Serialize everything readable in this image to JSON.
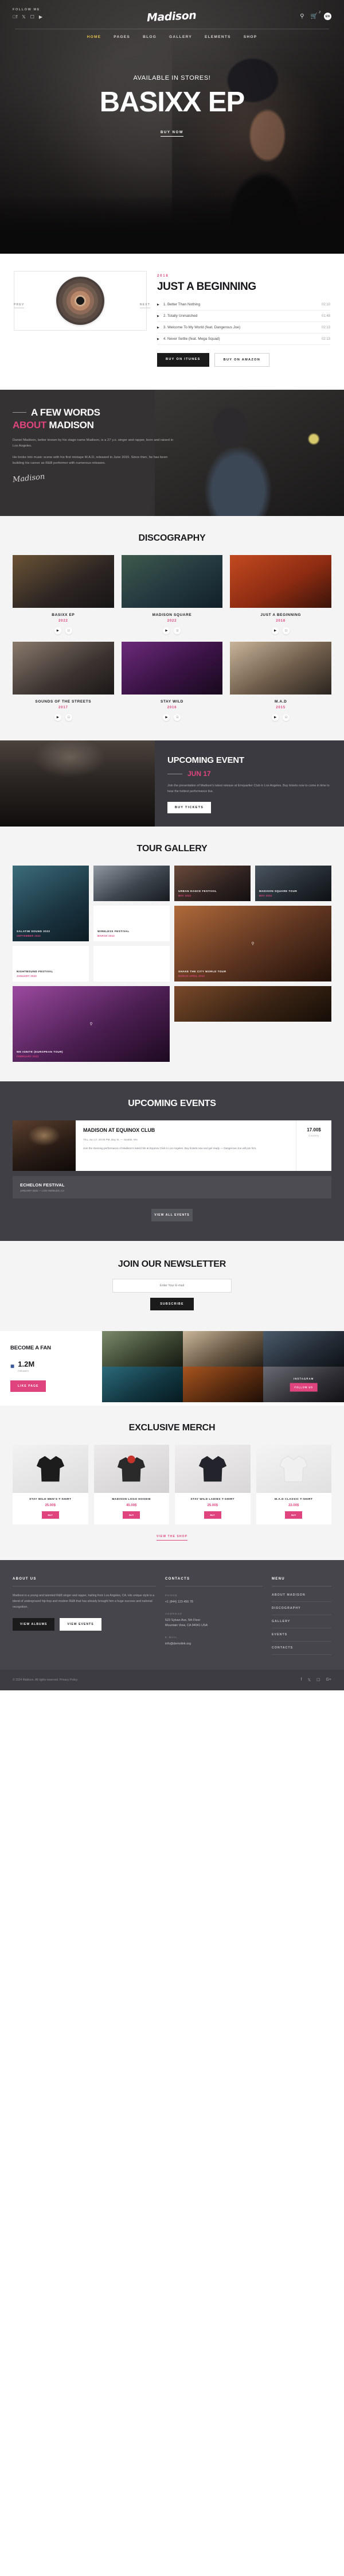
{
  "header": {
    "follow_label": "FOLLOW ME",
    "social": [
      "facebook-icon",
      "twitter-icon",
      "instagram-icon",
      "youtube-icon"
    ],
    "brand": "Madison",
    "search_icon": "search-icon",
    "cart_icon": "cart-icon",
    "cart_count": "2",
    "lang": "EN",
    "nav": [
      {
        "label": "HOME",
        "active": true
      },
      {
        "label": "PAGES",
        "active": false
      },
      {
        "label": "BLOG",
        "active": false
      },
      {
        "label": "GALLERY",
        "active": false
      },
      {
        "label": "ELEMENTS",
        "active": false
      },
      {
        "label": "SHOP",
        "active": false
      }
    ]
  },
  "hero": {
    "eyebrow": "AVAILABLE IN STORES!",
    "title": "BASIXX EP",
    "cta": "BUY NOW"
  },
  "album": {
    "prev": "PREV",
    "next": "NEXT",
    "year": "2018",
    "title": "JUST A BEGINNING",
    "tracks": [
      {
        "name": "1. Better Than Nothing",
        "duration": "02:10"
      },
      {
        "name": "2. Totally Unmatched",
        "duration": "01:48"
      },
      {
        "name": "3. Welcome To My World (feat. Dangerous Joe)",
        "duration": "02:13"
      },
      {
        "name": "4. Never Settle (feat. Mega Squad)",
        "duration": "02:13"
      }
    ],
    "buy_itunes": "BUY ON ITUNES",
    "buy_amazon": "BUY ON AMAZON"
  },
  "about": {
    "heading_line1": "A FEW WORDS",
    "heading_pink": "ABOUT",
    "heading_rest": "MADISON",
    "para1": "Daniel Madison, better known by his stage name Madison, is a 27 y.o. singer and rapper, born and raised in Los Angeles.",
    "para2": "He broke into music scene with his first mixtape M.A.D, released in June 2015. Since then, he has been building his career as R&B performer with numerous releases.",
    "signature": "Madison"
  },
  "discography": {
    "heading": "DISCOGRAPHY",
    "albums": [
      {
        "name": "BASIXX EP",
        "year": "2022"
      },
      {
        "name": "MADISON SQUARE",
        "year": "2022"
      },
      {
        "name": "JUST A BEGINNING",
        "year": "2018"
      },
      {
        "name": "SOUNDS OF THE STREETS",
        "year": "2017"
      },
      {
        "name": "STAY WILD",
        "year": "2016"
      },
      {
        "name": "M.A.D",
        "year": "2015"
      }
    ],
    "play_icon": "play-icon",
    "apple_icon": "apple-icon"
  },
  "upcoming_event": {
    "heading": "UPCOMING EVENT",
    "date": "JUN 17",
    "description": "Join the presentation of Madison's latest release at Emquartier Club in Los Angeles. Buy tickets now to come in time to hear the hottest performance live.",
    "cta": "BUY TICKETS"
  },
  "tour_gallery": {
    "heading": "TOUR GALLERY",
    "items": [
      {
        "title": "SALATIM SOUND 2022",
        "sub": "SEPTEMBER 2022"
      },
      {
        "title": "URBAN DANCE FESTIVAL",
        "sub": "MAY 2022"
      },
      {
        "title": "MADISON SQUARE TOUR",
        "sub": "MAY 2022"
      },
      {
        "title": "WIRELESS FESTIVAL",
        "sub": "MARCH 2022"
      },
      {
        "title": "NIGHTBOUND FESTIVAL",
        "sub": "JANUARY 2022"
      },
      {
        "title": "SHAKE THE CITY WORLD TOUR",
        "sub": "MARCH-APRIL 2022"
      },
      {
        "title": "WE IGNITE (EUROPEAN TOUR)",
        "sub": "FEBRUARY 2022"
      }
    ],
    "zoom_icon": "zoom-icon"
  },
  "events": {
    "heading": "UPCOMING EVENTS",
    "featured": {
      "title": "MADISON AT EQUINOX CLUB",
      "meta": "Thu, Jun 17, 20:00 PM, Bay St. — Seattle, WA",
      "desc": "Join the stunning performance of Madison's latest hits at Equinox Club in Los Angeles. Buy tickets now and get ready — Dangerous Joe will join him.",
      "price": "17.00$",
      "price_label": "Country"
    },
    "rows": [
      {
        "title": "ECHELON FESTIVAL",
        "meta": "JANUARY 2022 — LOS ANGELES, CA"
      }
    ],
    "more": "VIEW ALL EVENTS"
  },
  "newsletter": {
    "heading_light": "JOIN OUR",
    "heading_bold": "NEWSLETTER",
    "placeholder": "Enter Your E-mail",
    "button": "SUBSCRIBE"
  },
  "fan": {
    "heading": "BECOME A FAN",
    "icon": "facebook-icon",
    "count": "1.2M",
    "count_label": "Followers",
    "button": "LIKE PAGE",
    "instagram_label": "INSTAGRAM",
    "instagram_button": "FOLLOW US"
  },
  "merch": {
    "heading": "EXCLUSIVE MERCH",
    "products": [
      {
        "name": "STAY WILD MEN'S T-SHIRT",
        "price": "25.00$",
        "button": "BUY"
      },
      {
        "name": "MADISON LOGO HOODIE",
        "price": "45.00$",
        "button": "BUY"
      },
      {
        "name": "STAY WILD LADIES T-SHIRT",
        "price": "25.00$",
        "button": "BUY"
      },
      {
        "name": "M.A.D CLASSIC T-SHIRT",
        "price": "22.00$",
        "button": "BUY"
      }
    ],
    "view_all": "VIEW THE SHOP"
  },
  "footer": {
    "about_heading": "ABOUT US",
    "about_text": "Madison is a young and talented R&B singer and rapper, hailing from Los Angeles, CA. His unique style is a blend of underground hip-hop and modern R&B that has already brought him a huge success and national recognition.",
    "btn_albums": "VIEW ALBUMS",
    "btn_events": "VIEW EVENTS",
    "contacts_heading": "CONTACTS",
    "phone_label": "PHONE",
    "phone": "+1 (844) 123 456 78",
    "address_label": "ADDRESS",
    "address": "523 Sylvan Ave, 5th Floor\nMountain View, CA 94041 USA",
    "email_label": "E-MAIL",
    "email": "info@demolink.org",
    "menu_heading": "MENU",
    "menu": [
      "ABOUT MADISON",
      "DISCOGRAPHY",
      "GALLERY",
      "EVENTS",
      "CONTACTS"
    ],
    "copyright": "© 2024 Madison. All rights reserved. Privacy Policy.",
    "social": [
      "facebook-icon",
      "twitter-icon",
      "instagram-icon",
      "googleplus-icon"
    ]
  }
}
